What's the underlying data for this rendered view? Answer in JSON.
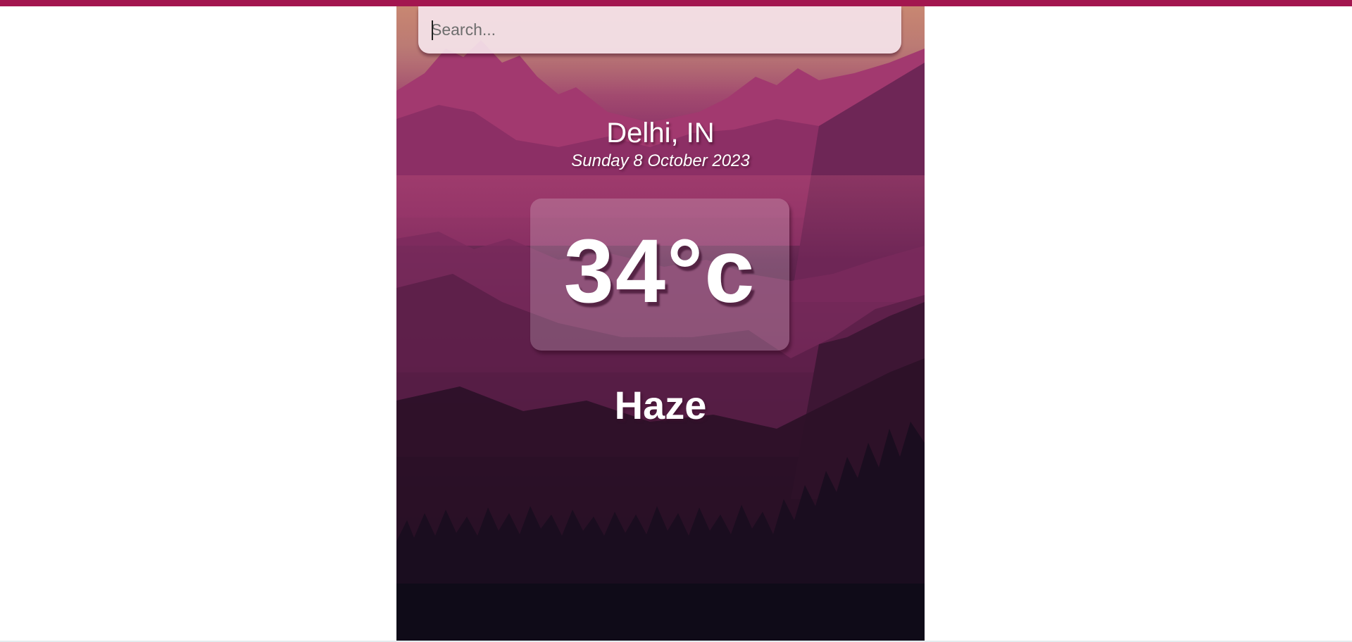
{
  "search": {
    "placeholder": "Search...",
    "value": ""
  },
  "weather": {
    "location": "Delhi, IN",
    "date": "Sunday 8 October 2023",
    "temperature": "34°c",
    "condition": "Haze"
  },
  "colors": {
    "top_bar": "#a3164f",
    "search_bg": "#f5e4ea",
    "text": "#ffffff"
  }
}
